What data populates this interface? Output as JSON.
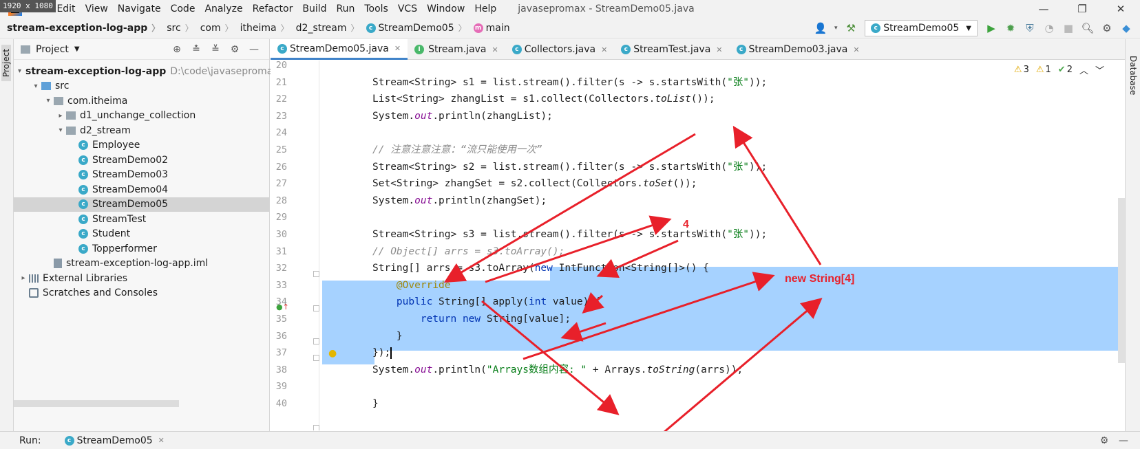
{
  "badge": "1920 x 1080",
  "menu": [
    "File",
    "Edit",
    "View",
    "Navigate",
    "Code",
    "Analyze",
    "Refactor",
    "Build",
    "Run",
    "Tools",
    "VCS",
    "Window",
    "Help"
  ],
  "window_title": "javasepromax - StreamDemo05.java",
  "window_controls": [
    "—",
    "❐",
    "✕"
  ],
  "breadcrumbs": [
    "stream-exception-log-app",
    "src",
    "com",
    "itheima",
    "d2_stream",
    "StreamDemo05",
    "main"
  ],
  "run_config": "StreamDemo05",
  "project_panel": {
    "title": "Project",
    "tree": [
      {
        "label": "stream-exception-log-app",
        "path": "D:\\code\\javasepromax\\",
        "indent": 0,
        "arrow": "▾",
        "icon": "module",
        "bold": true
      },
      {
        "label": "src",
        "indent": 1,
        "arrow": "▾",
        "icon": "folder-blue"
      },
      {
        "label": "com.itheima",
        "indent": 2,
        "arrow": "▾",
        "icon": "folder"
      },
      {
        "label": "d1_unchange_collection",
        "indent": 3,
        "arrow": "▸",
        "icon": "folder"
      },
      {
        "label": "d2_stream",
        "indent": 3,
        "arrow": "▾",
        "icon": "folder"
      },
      {
        "label": "Employee",
        "indent": 4,
        "arrow": "",
        "icon": "class"
      },
      {
        "label": "StreamDemo02",
        "indent": 4,
        "arrow": "",
        "icon": "class"
      },
      {
        "label": "StreamDemo03",
        "indent": 4,
        "arrow": "",
        "icon": "class"
      },
      {
        "label": "StreamDemo04",
        "indent": 4,
        "arrow": "",
        "icon": "class"
      },
      {
        "label": "StreamDemo05",
        "indent": 4,
        "arrow": "",
        "icon": "class",
        "selected": true
      },
      {
        "label": "StreamTest",
        "indent": 4,
        "arrow": "",
        "icon": "class"
      },
      {
        "label": "Student",
        "indent": 4,
        "arrow": "",
        "icon": "class"
      },
      {
        "label": "Topperformer",
        "indent": 4,
        "arrow": "",
        "icon": "class"
      },
      {
        "label": "stream-exception-log-app.iml",
        "indent": 2,
        "arrow": "",
        "icon": "iml"
      },
      {
        "label": "External Libraries",
        "indent": 0,
        "arrow": "▸",
        "icon": "lib"
      },
      {
        "label": "Scratches and Consoles",
        "indent": 0,
        "arrow": "",
        "icon": "scratch"
      }
    ]
  },
  "tabs": [
    {
      "label": "StreamDemo05.java",
      "icon": "c",
      "active": true
    },
    {
      "label": "Stream.java",
      "icon": "i"
    },
    {
      "label": "Collectors.java",
      "icon": "c"
    },
    {
      "label": "StreamTest.java",
      "icon": "c"
    },
    {
      "label": "StreamDemo03.java",
      "icon": "c"
    }
  ],
  "inspections": {
    "warnings": "3",
    "weak_warnings": "1",
    "typos": "2"
  },
  "code_lines": [
    {
      "n": "20",
      "html": ""
    },
    {
      "n": "21",
      "html": "Stream&lt;String&gt; s1 = list.stream().filter(s -&gt; s.startsWith(<span class=\"str\">\"张\"</span>));"
    },
    {
      "n": "22",
      "html": "List&lt;String&gt; zhangList = s1.collect(Collectors.<span class=\"itl\">toList</span>());"
    },
    {
      "n": "23",
      "html": "System.<span class=\"fld\">out</span>.println(zhangList);"
    },
    {
      "n": "24",
      "html": ""
    },
    {
      "n": "25",
      "html": "<span class=\"cm\">// 注意注意注意：“流只能使用一次”</span>"
    },
    {
      "n": "26",
      "html": "Stream&lt;String&gt; s2 = list.stream().filter(s -&gt; s.startsWith(<span class=\"str\">\"张\"</span>));"
    },
    {
      "n": "27",
      "html": "Set&lt;String&gt; zhangSet = s2.collect(Collectors.<span class=\"itl\">toSet</span>());"
    },
    {
      "n": "28",
      "html": "System.<span class=\"fld\">out</span>.println(zhangSet);"
    },
    {
      "n": "29",
      "html": ""
    },
    {
      "n": "30",
      "html": "Stream&lt;String&gt; s3 = list.stream().filter(s -&gt; s.startsWith(<span class=\"str\">\"张\"</span>));"
    },
    {
      "n": "31",
      "html": "<span class=\"cm\">// Object[] arrs = s3.toArray();</span>"
    },
    {
      "n": "32",
      "html": "String[] arrs = s3.toArray(<span class=\"kw\">new</span> IntFunction&lt;String[]&gt;() {"
    },
    {
      "n": "33",
      "html": "    <span class=\"anno\">@Override</span>"
    },
    {
      "n": "34",
      "html": "    <span class=\"kw\">public</span> String[] apply(<span class=\"kw\">int</span> value) {"
    },
    {
      "n": "35",
      "html": "        <span class=\"kw\">return new</span> String[value];"
    },
    {
      "n": "36",
      "html": "    }"
    },
    {
      "n": "37",
      "html": "});<span class=\"caret-bar\"></span>"
    },
    {
      "n": "38",
      "html": "System.<span class=\"fld\">out</span>.println(<span class=\"str\">\"Arrays数组内容: \"</span> + Arrays.<span class=\"itl\">toString</span>(arrs));"
    },
    {
      "n": "39",
      "html": ""
    },
    {
      "n": "40",
      "html": "}"
    }
  ],
  "annotations": {
    "label_4": "4",
    "label_new": "new String[4]"
  },
  "run_bar": {
    "label": "Run:",
    "tab": "StreamDemo05"
  },
  "right_stripe": "Database",
  "left_stripe": "Project",
  "colors": {
    "selection": "#a6d2ff",
    "arrows": "#e8202a",
    "keyword": "#0033b3",
    "string": "#067d17"
  }
}
